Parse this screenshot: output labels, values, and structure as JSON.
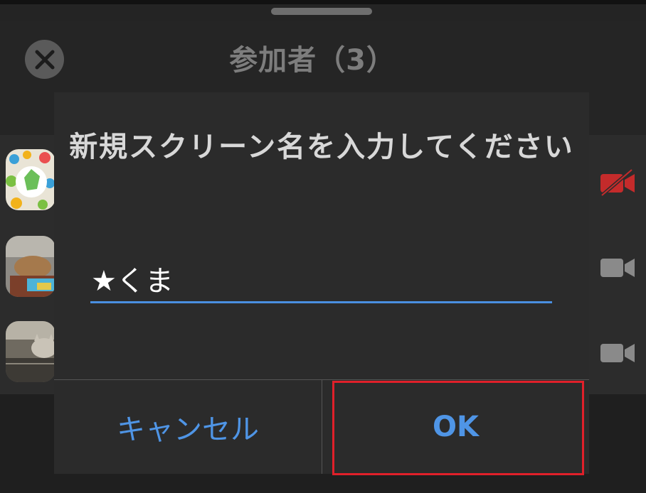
{
  "sheet": {
    "title": "参加者（3）"
  },
  "dialog": {
    "message": "新規スクリーン名を入力してください",
    "input_value": "★くま",
    "cancel_label": "キャンセル",
    "ok_label": "OK"
  },
  "participants": [
    {
      "avatar": "avatar-icon",
      "camera": "camera-off-icon"
    },
    {
      "avatar": "avatar-photo-capybara",
      "camera": "camera-icon"
    },
    {
      "avatar": "avatar-photo-cat",
      "camera": "camera-icon"
    }
  ],
  "colors": {
    "accent": "#4a8fe0",
    "button_text": "#4f95e6",
    "highlight": "#e0202a",
    "camera_off": "#c42b2b",
    "camera_on": "#8a8a8a"
  }
}
